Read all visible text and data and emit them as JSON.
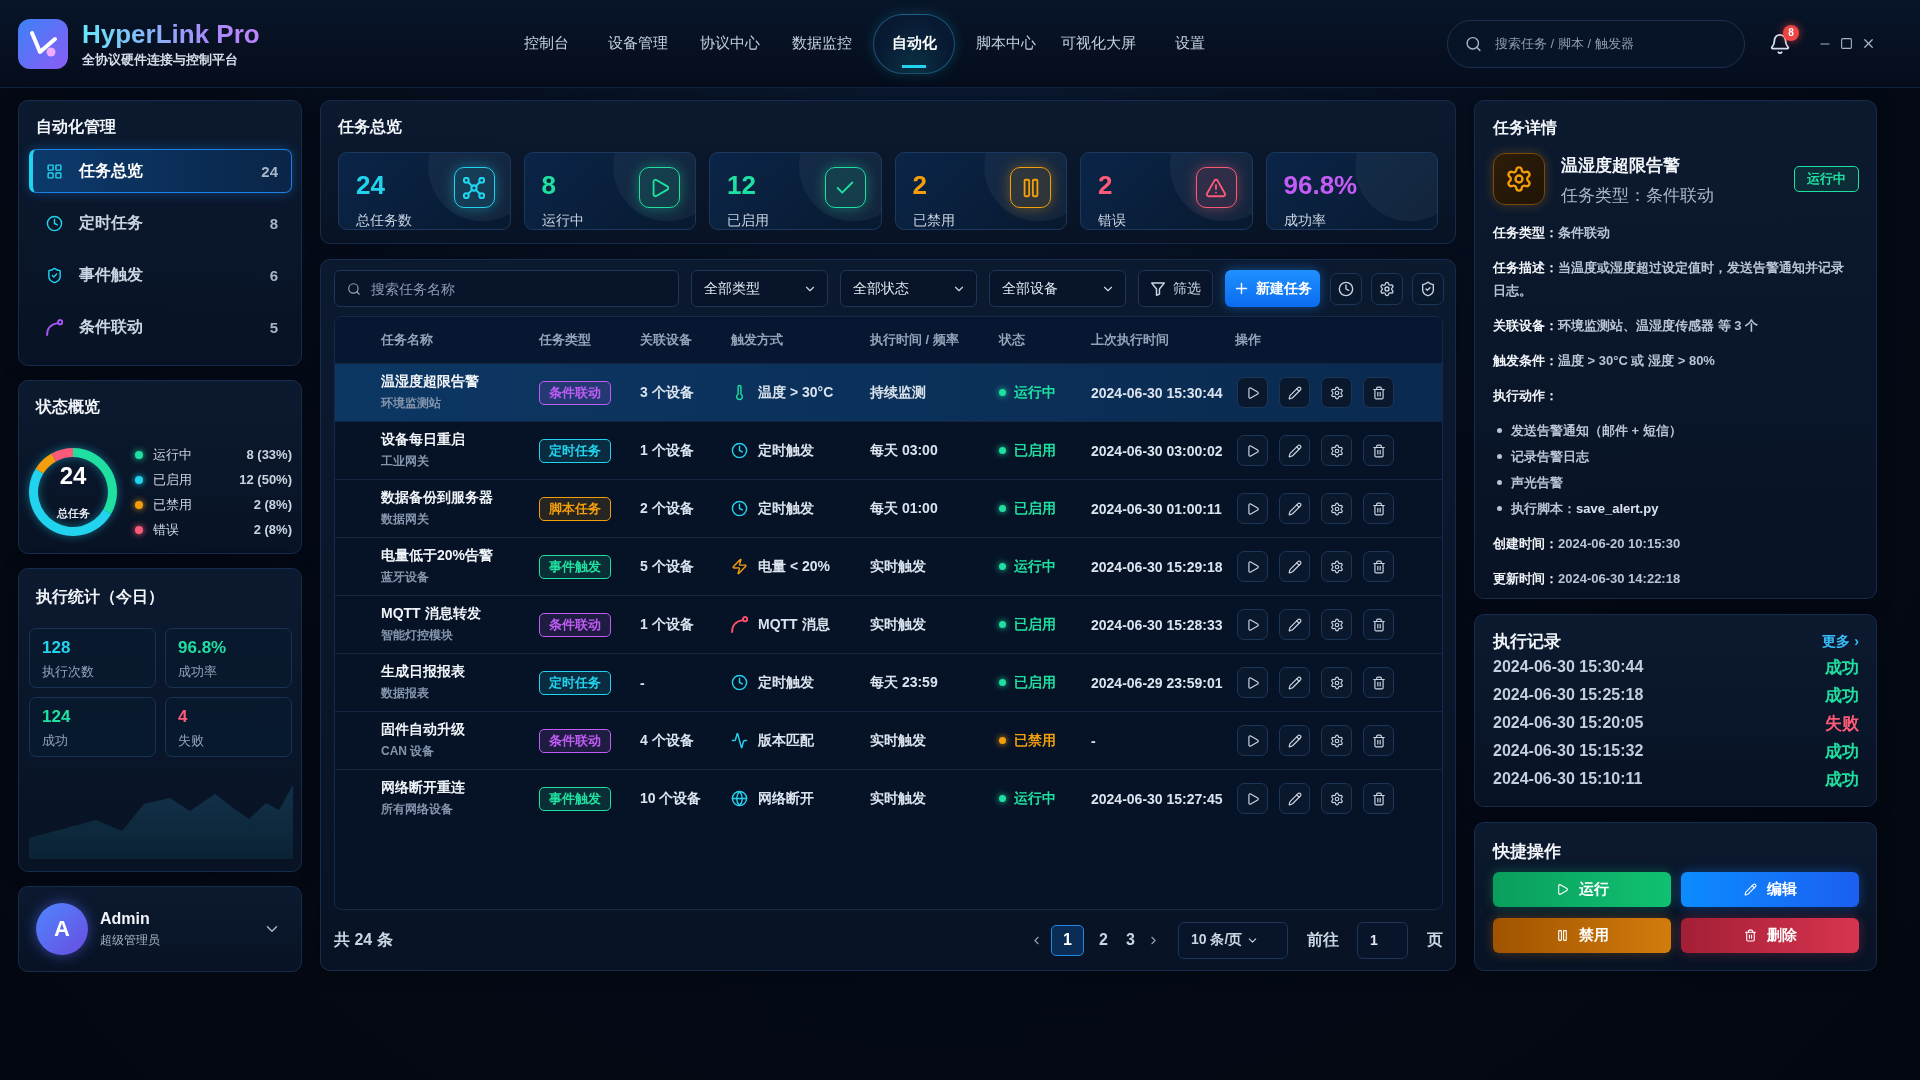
{
  "app": {
    "name": "HyperLink Pro",
    "tagline": "全协议硬件连接与控制平台"
  },
  "nav": [
    {
      "label": "控制台",
      "selected": false
    },
    {
      "label": "设备管理",
      "selected": false
    },
    {
      "label": "协议中心",
      "selected": false
    },
    {
      "label": "数据监控",
      "selected": false
    },
    {
      "label": "自动化",
      "selected": true
    },
    {
      "label": "脚本中心",
      "selected": false
    },
    {
      "label": "可视化大屏",
      "selected": false
    },
    {
      "label": "设置",
      "selected": false
    }
  ],
  "search": {
    "placeholder": "搜索任务 / 脚本 / 触发器"
  },
  "notifications": {
    "count": "8"
  },
  "sidebar": {
    "title": "自动化管理",
    "items": [
      {
        "kind": "overview",
        "label": "任务总览",
        "count": "24",
        "selected": true
      },
      {
        "kind": "scheduled",
        "label": "定时任务",
        "count": "8",
        "selected": false
      },
      {
        "kind": "event",
        "label": "事件触发",
        "count": "6",
        "selected": false
      },
      {
        "kind": "linkage",
        "label": "条件联动",
        "count": "5",
        "selected": false
      }
    ]
  },
  "status_overview": {
    "title": "状态概览",
    "total": "24",
    "total_label": "总任务",
    "legend": [
      {
        "reading": "8 (33%)",
        "color": "#1fe0a0"
      },
      {
        "reading": "12 (50%)",
        "color": "#22d3ee"
      },
      {
        "reading": "2 (8%)",
        "color": "#f59e0b"
      },
      {
        "reading": "2 (8%)",
        "color": "#fb5a78"
      }
    ],
    "chart_data": {
      "type": "donut",
      "categories": [
        "运行中",
        "已启用",
        "已禁用",
        "错误"
      ],
      "values": [
        33,
        50,
        8,
        8
      ]
    }
  },
  "execution_stats": {
    "title": "执行统计（今日）",
    "metrics": [
      {
        "value": "128",
        "label": "执行次数",
        "color": "#22d3ee"
      },
      {
        "value": "96.8%",
        "label": "成功率",
        "color": "#1fe0a0"
      },
      {
        "value": "124",
        "label": "成功",
        "color": "#1fe0a0"
      },
      {
        "value": "4",
        "label": "失败",
        "color": "#fb5a78"
      }
    ]
  },
  "user": {
    "initial": "A",
    "name": "Admin",
    "role": "超级管理员"
  },
  "task_overview": {
    "title": "任务总览",
    "cards": [
      {
        "kind": "total",
        "value": "24",
        "label": "总任务数",
        "color": "#22d3ee"
      },
      {
        "kind": "running",
        "value": "8",
        "label": "运行中",
        "color": "#1fe0a0"
      },
      {
        "kind": "enabled",
        "value": "12",
        "label": "已启用",
        "color": "#1fe0a0"
      },
      {
        "kind": "disabled",
        "value": "2",
        "label": "已禁用",
        "color": "#f59e0b"
      },
      {
        "kind": "error",
        "value": "2",
        "label": "错误",
        "color": "#fb5a78"
      },
      {
        "kind": "rate",
        "value": "96.8%",
        "label": "成功率",
        "color": "#c45cf6"
      }
    ]
  },
  "toolbar": {
    "search": {
      "placeholder": "搜索任务名称"
    },
    "filters": [
      {
        "value": "全部类型"
      },
      {
        "value": "全部状态"
      },
      {
        "value": "全部设备"
      }
    ],
    "filter_button": "筛选",
    "create_button": "新建任务"
  },
  "table": {
    "columns": [
      "任务名称",
      "任务类型",
      "关联设备",
      "触发方式",
      "执行时间 / 频率",
      "状态",
      "上次执行时间",
      "操作"
    ],
    "rows": [
      {
        "name": "温湿度超限告警",
        "group": "环境监测站",
        "type": {
          "label": "条件联动",
          "color": "#c05cf5"
        },
        "devices": "3 个设备",
        "trigger": {
          "kind": "temperature",
          "label": "温度 > 30°C"
        },
        "schedule": "持续监测",
        "status": {
          "label": "运行中",
          "color": "#1fe0a0"
        },
        "last_run": "2024-06-30 15:30:44",
        "selected": true
      },
      {
        "name": "设备每日重启",
        "group": "工业网关",
        "type": {
          "label": "定时任务",
          "color": "#22d3ee"
        },
        "devices": "1 个设备",
        "trigger": {
          "kind": "schedule",
          "label": "定时触发"
        },
        "schedule": "每天 03:00",
        "status": {
          "label": "已启用",
          "color": "#1fe0a0"
        },
        "last_run": "2024-06-30 03:00:02",
        "selected": false
      },
      {
        "name": "数据备份到服务器",
        "group": "数据网关",
        "type": {
          "label": "脚本任务",
          "color": "#f59e0b"
        },
        "devices": "2 个设备",
        "trigger": {
          "kind": "schedule",
          "label": "定时触发"
        },
        "schedule": "每天 01:00",
        "status": {
          "label": "已启用",
          "color": "#1fe0a0"
        },
        "last_run": "2024-06-30 01:00:11",
        "selected": false
      },
      {
        "name": "电量低于20%告警",
        "group": "蓝牙设备",
        "type": {
          "label": "事件触发",
          "color": "#1fe0a0"
        },
        "devices": "5 个设备",
        "trigger": {
          "kind": "battery",
          "label": "电量 < 20%"
        },
        "schedule": "实时触发",
        "status": {
          "label": "运行中",
          "color": "#1fe0a0"
        },
        "last_run": "2024-06-30 15:29:18",
        "selected": false
      },
      {
        "name": "MQTT 消息转发",
        "group": "智能灯控模块",
        "type": {
          "label": "条件联动",
          "color": "#c05cf5"
        },
        "devices": "1 个设备",
        "trigger": {
          "kind": "mqtt",
          "label": "MQTT 消息"
        },
        "schedule": "实时触发",
        "status": {
          "label": "已启用",
          "color": "#1fe0a0"
        },
        "last_run": "2024-06-30 15:28:33",
        "selected": false
      },
      {
        "name": "生成日报报表",
        "group": "数据报表",
        "type": {
          "label": "定时任务",
          "color": "#22d3ee"
        },
        "devices": "-",
        "trigger": {
          "kind": "schedule",
          "label": "定时触发"
        },
        "schedule": "每天 23:59",
        "status": {
          "label": "已启用",
          "color": "#1fe0a0"
        },
        "last_run": "2024-06-29 23:59:01",
        "selected": false
      },
      {
        "name": "固件自动升级",
        "group": "CAN 设备",
        "type": {
          "label": "条件联动",
          "color": "#c05cf5"
        },
        "devices": "4 个设备",
        "trigger": {
          "kind": "version",
          "label": "版本匹配"
        },
        "schedule": "实时触发",
        "status": {
          "label": "已禁用",
          "color": "#f59e0b"
        },
        "last_run": "-",
        "selected": false
      },
      {
        "name": "网络断开重连",
        "group": "所有网络设备",
        "type": {
          "label": "事件触发",
          "color": "#1fe0a0"
        },
        "devices": "10 个设备",
        "trigger": {
          "kind": "network",
          "label": "网络断开"
        },
        "schedule": "实时触发",
        "status": {
          "label": "运行中",
          "color": "#1fe0a0"
        },
        "last_run": "2024-06-30 15:27:45",
        "selected": false
      }
    ]
  },
  "pagination": {
    "total": "共 24 条",
    "pages": [
      {
        "label": "1",
        "selected": true
      },
      {
        "label": "2",
        "selected": false
      },
      {
        "label": "3",
        "selected": false
      }
    ],
    "page_size": "10 条/页",
    "goto_label": "前往",
    "goto_value": "1",
    "goto_suffix": "页"
  },
  "task_detail": {
    "title": "任务详情",
    "name": "温湿度超限告警",
    "subtitle": "任务类型：条件联动",
    "status": {
      "label": "运行中",
      "color": "#1fe0a0"
    },
    "fields": [
      "**任务类型：**条件联动",
      "**任务描述：**当温度或湿度超过设定值时，发送告警通知并记录日志。",
      "**关联设备：**环境监测站、温湿度传感器 等 3 个",
      "**触发条件：**温度 > 30°C 或 湿度 > 80%"
    ],
    "actions_label": "执行动作：",
    "actions": [
      "发送告警通知（邮件 + 短信）",
      "记录告警日志",
      "声光告警",
      "执行脚本：**save_alert.py**"
    ],
    "timestamps": [
      "**创建时间：**2024-06-20 10:15:30",
      "**更新时间：**2024-06-30 14:22:18"
    ]
  },
  "execution_log": {
    "title": "执行记录",
    "more": "更多 ›",
    "entries": [
      {
        "time": "2024-06-30 15:30:44",
        "result": "成功",
        "color": "#1fe0a0"
      },
      {
        "time": "2024-06-30 15:25:18",
        "result": "成功",
        "color": "#1fe0a0"
      },
      {
        "time": "2024-06-30 15:20:05",
        "result": "失败",
        "color": "#fb5a78"
      },
      {
        "time": "2024-06-30 15:15:32",
        "result": "成功",
        "color": "#1fe0a0"
      },
      {
        "time": "2024-06-30 15:10:11",
        "result": "成功",
        "color": "#1fe0a0"
      }
    ]
  },
  "quick_actions": {
    "title": "快捷操作",
    "buttons": [
      {
        "kind": "run",
        "label": "运行"
      },
      {
        "kind": "edit",
        "label": "编辑"
      },
      {
        "kind": "disable",
        "label": "禁用"
      },
      {
        "kind": "delete",
        "label": "删除"
      }
    ]
  }
}
